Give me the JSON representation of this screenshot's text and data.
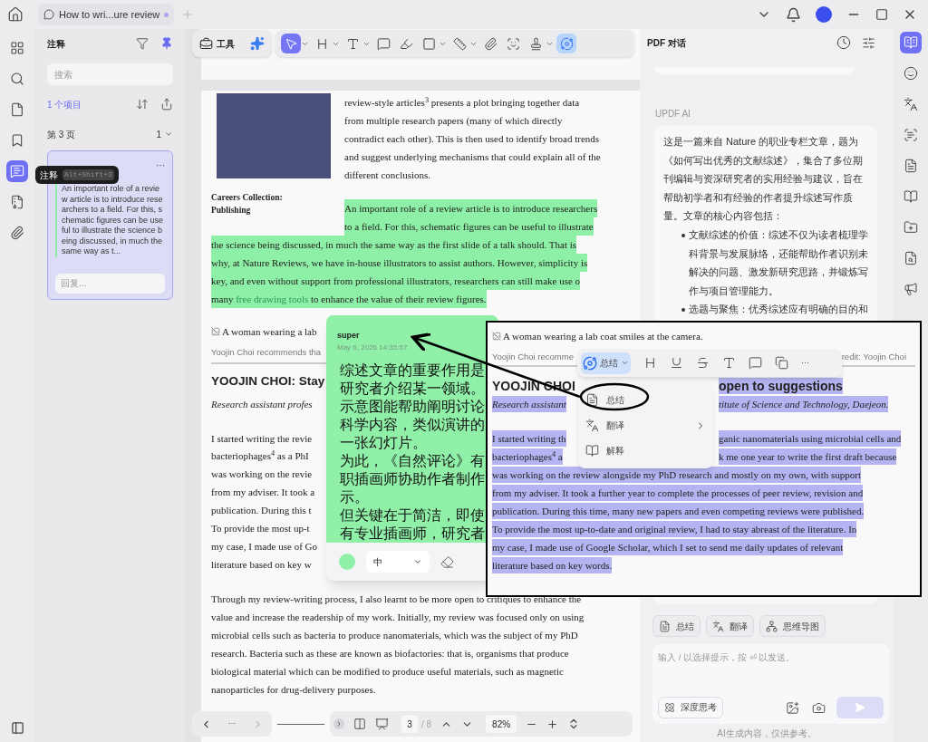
{
  "top_bar": {
    "tab": {
      "title": "How to wri...ure review",
      "modified": true
    }
  },
  "left_rail": {
    "items": [
      {
        "kind": "grid",
        "selected": false
      },
      {
        "kind": "search",
        "selected": false
      },
      {
        "kind": "pages",
        "selected": false
      },
      {
        "kind": "bookmark",
        "selected": false
      },
      {
        "kind": "comment",
        "selected": true
      },
      {
        "kind": "form",
        "selected": false
      },
      {
        "kind": "attachment",
        "selected": false
      }
    ]
  },
  "tooltip": {
    "label": "注释",
    "shortcut": "Alt+Shift+3"
  },
  "annotations_panel": {
    "title": "注释",
    "search": {
      "placeholder": "搜索"
    },
    "count": "1 个项目",
    "page_label": "第 3 页",
    "page_count": "1",
    "card": {
      "more": "···",
      "text": "An important role of a review article is to introduce researchers to a field. For this, schematic figures can be useful to illustrate the science being discussed, in much the same way as t...",
      "reply": {
        "placeholder": "回复..."
      }
    }
  },
  "toolbar": {
    "tools_label": "工具",
    "tools": [
      {
        "kind": "select",
        "selected": true,
        "has_menu": true
      },
      {
        "kind": "heading",
        "selected": false,
        "has_menu": true
      },
      {
        "kind": "text",
        "selected": false,
        "has_menu": true
      },
      {
        "kind": "comment",
        "selected": false,
        "has_menu": false
      },
      {
        "kind": "highlighter",
        "selected": false,
        "has_menu": false
      },
      {
        "kind": "shape",
        "selected": false,
        "has_menu": true
      },
      {
        "kind": "measure",
        "selected": false,
        "has_menu": true
      },
      {
        "kind": "attach",
        "selected": false,
        "has_menu": false
      },
      {
        "kind": "signature",
        "selected": false,
        "has_menu": false
      },
      {
        "kind": "stamp",
        "selected": false,
        "has_menu": true
      },
      {
        "kind": "ai",
        "selected": true,
        "has_menu": false
      }
    ]
  },
  "document": {
    "figure_caption": "Careers Collection: Publishing",
    "intro_lines": [
      "review-style articles$^{3}$ presents a plot bringing together data",
      "from multiple research papers (many of which directly",
      "contradict each other). This is then used to identify broad trends",
      "and suggest underlying mechanisms that could explain all of the",
      "different conclusions."
    ],
    "highlight": {
      "highlighted": true,
      "side_lines": [
        "An important role of a review article is to introduce researchers",
        "to a field. For this, schematic figures can be useful to illustrate"
      ],
      "full_lines": [
        "the science being discussed, in much the same way as the first slide of a talk should. That is",
        "why, at Nature Reviews, we have in-house illustrators to assist authors. However, simplicity is",
        "key, and even without support from professional illustrators, researchers can still make use o"
      ],
      "last_line": {
        "before": "many ",
        "link": "free drawing tools",
        "after": " to enhance the value of their review figures."
      }
    },
    "photo_alt": "A woman wearing a lab",
    "photo_caption": "Yoojin Choi recommends tha",
    "heading": "YOOJIN CHOI: Stay",
    "subheading": "Research assistant profes",
    "body_lines": [
      "I started writing the revie",
      "bacteriophages$^{4}$ as a PhI",
      "was working on the revie",
      "from my adviser. It took a",
      "publication. During this t",
      "To provide the most up-t",
      "my case, I made use of Go",
      "literature based on key w"
    ],
    "closing_lines": [
      "Through my review-writing process, I also learnt to be more open to critiques to enhance the",
      "value and increase the readership of my work. Initially, my review was focused only on using",
      "microbial cells such as bacteria to produce nanomaterials, which was the subject of my PhD",
      "research. Bacteria such as these are known as biofactories: that is, organisms that produce",
      "biological material which can be modified to produce useful materials, such as magnetic",
      "nanoparticles for drug-delivery purposes."
    ]
  },
  "sticky_note": {
    "author": "super",
    "date": "May 6, 2026 14:35:57",
    "color": "#90f0a8",
    "size": "中",
    "lines": [
      "综述文章的重要作用是",
      "研究者介绍某一领域。",
      "示意图能帮助阐明讨论",
      "科学内容，类似演讲的",
      "一张幻灯片。",
      "为此，《自然评论》有",
      "职插画师协助作者制作",
      "示。",
      "但关键在于简洁，即使",
      "有专业插画师，研究者"
    ]
  },
  "zoom_inset": {
    "photo_alt": "A woman wearing a lab coat smiles at the camera.",
    "caption_left": "Yoojin Choi recomme",
    "caption_right": "redit: Yoojin Choi",
    "rows": [
      {
        "kind": "heading",
        "parts": [
          {
            "text": "YOOJIN CHOI",
            "selected": false
          },
          {
            "text": "open to suggestions",
            "selected": true
          }
        ]
      },
      {
        "kind": "italic",
        "parts": [
          {
            "text": "Research assistant",
            "selected": true
          },
          {
            "text": "titute of Science and Technology, Daejeon.",
            "selected": true
          }
        ]
      },
      {
        "kind": "body",
        "parts": [
          {
            "text": "I started writing th",
            "selected": true
          },
          {
            "text": "ganic nanomaterials using microbial cells and",
            "selected": true
          }
        ]
      },
      {
        "kind": "body",
        "parts": [
          {
            "text": "bacteriophages$^{4}$ a",
            "selected": true
          },
          {
            "text": "k me one year to write the first draft because",
            "selected": true
          }
        ]
      },
      {
        "kind": "body",
        "parts": [
          {
            "text": "was working on the review alongside my PhD research and mostly on my own, with support",
            "selected": true
          }
        ]
      },
      {
        "kind": "body",
        "parts": [
          {
            "text": "from my adviser. It took a further year to complete the processes of peer review, revision and",
            "selected": true
          }
        ]
      },
      {
        "kind": "body",
        "parts": [
          {
            "text": "publication. During this time, many new papers and even competing reviews were published.",
            "selected": true
          }
        ]
      },
      {
        "kind": "body",
        "parts": [
          {
            "text": "To provide the most up-to-date and original review, I had to stay abreast of the literature. In",
            "selected": true
          }
        ]
      },
      {
        "kind": "body",
        "parts": [
          {
            "text": "my case, I made use of Google Scholar, which I set to send me daily updates of relevant",
            "selected": true
          }
        ]
      },
      {
        "kind": "body",
        "parts": [
          {
            "text": "literature based on key words.",
            "selected": true
          }
        ]
      }
    ],
    "toolbar": {
      "action": "总结",
      "more": "···"
    },
    "menu": [
      {
        "kind": "summarize",
        "label": "总结",
        "submenu": false
      },
      {
        "kind": "translate",
        "label": "翻译",
        "submenu": true
      },
      {
        "kind": "explain",
        "label": "解释",
        "submenu": false
      }
    ]
  },
  "ai_panel": {
    "title": "PDF 对话",
    "sender": "UPDF AI",
    "intro": "这是一篇来自 Nature 的职业专栏文章，题为《如何写出优秀的文献综述》，集合了多位期刊编辑与资深研究者的实用经验与建议，旨在帮助初学者和有经验的作者提升综述写作质量。文章的核心内容包括：",
    "bullets": [
      "文献综述的价值：综述不仅为读者梳理学科背景与发展脉络，还能帮助作者识别未解决的问题、激发新研究思路，并锻炼写作与项目管理能力。",
      "选题与聚焦：优秀综述应有明确的目的和"
    ],
    "actions": [
      {
        "kind": "summarize",
        "label": "总结"
      },
      {
        "kind": "translate",
        "label": "翻译"
      },
      {
        "kind": "mindmap",
        "label": "思维导图"
      }
    ],
    "input": {
      "placeholder": "输入 / 以选择提示，按 ⏎ 以发送。"
    },
    "deep_think": "深度思考",
    "send_disabled": true,
    "disclaimer": "AI生成内容，仅供参考。"
  },
  "right_rail": {
    "items": [
      {
        "kind": "reader",
        "selected": true
      },
      {
        "kind": "chat",
        "selected": false
      },
      {
        "kind": "translate",
        "selected": false
      },
      {
        "kind": "ocr",
        "selected": false
      },
      {
        "kind": "summary",
        "selected": false
      },
      {
        "kind": "book",
        "selected": false
      },
      {
        "kind": "folder",
        "selected": false
      },
      {
        "kind": "search",
        "selected": false
      },
      {
        "kind": "promo",
        "selected": false
      }
    ]
  },
  "bottom_nav": {
    "more": "···",
    "page": "3",
    "total": "/ 8",
    "zoom": "82%"
  }
}
